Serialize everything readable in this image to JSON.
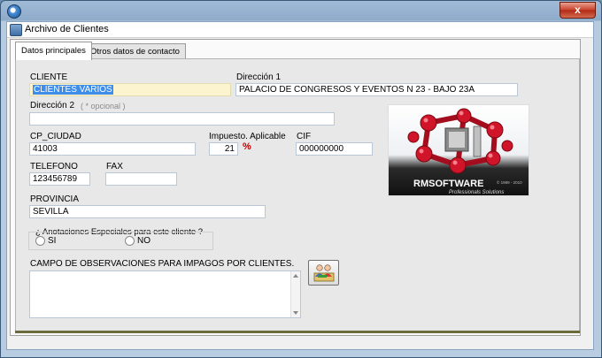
{
  "window": {
    "app_icon": "app-globe-icon",
    "close_label": "x",
    "inner_title": "Archivo de Clientes"
  },
  "tabs": [
    {
      "label": "Datos principales",
      "active": true
    },
    {
      "label": "Otros datos de contacto",
      "active": false
    }
  ],
  "form": {
    "cliente_label": "CLIENTE",
    "cliente_value": "CLIENTES VARIOS",
    "direccion1_label": "Dirección 1",
    "direccion1_value": "PALACIO DE CONGRESOS Y EVENTOS N 23 - BAJO 23A",
    "direccion2_label": "Dirección 2",
    "direccion2_hint": "( * opcional )",
    "direccion2_value": "",
    "cp_label": "CP_CIUDAD",
    "cp_value": "41003",
    "impuesto_label": "Impuesto. Aplicable",
    "impuesto_value": "21",
    "impuesto_unit": "%",
    "cif_label": "CIF",
    "cif_value": "000000000",
    "telefono_label": "TELEFONO",
    "telefono_value": "123456789",
    "fax_label": "FAX",
    "fax_value": "",
    "provincia_label": "PROVINCIA",
    "provincia_value": "SEVILLA",
    "anotaciones_label": "¿ Anotaciones Especiales para este cliente  ?",
    "radio_si": "SI",
    "radio_no": "NO",
    "observaciones_label": "CAMPO DE OBSERVACIONES PARA IMPAGOS POR CLIENTES.",
    "observaciones_value": ""
  },
  "logo": {
    "brand": "RMSOFTWARE",
    "tagline": "Professionals Solutions",
    "years": "© 1989 - 2010"
  },
  "colors": {
    "title_bar": "#8eabca",
    "close_button": "#c8402a",
    "selection": "#3e8de8",
    "logo_red": "#d0142a"
  }
}
